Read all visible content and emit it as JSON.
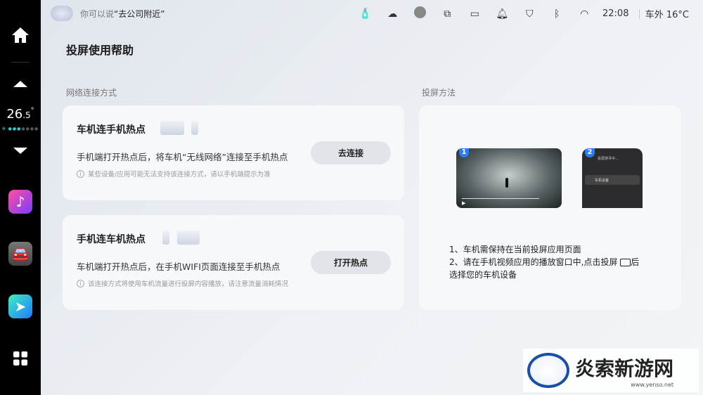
{
  "voice_hint": {
    "prefix": "你可以说",
    "command": "“去公司附近”"
  },
  "status": {
    "time": "22:08",
    "outside_temp": "车外 16°C",
    "icons": [
      "bottle-icon",
      "cloud-check-icon",
      "avatar-icon",
      "multi-screen-icon",
      "camera-icon",
      "bell-icon",
      "shield-check-icon",
      "bluetooth-icon",
      "wifi-icon"
    ]
  },
  "sidebar": {
    "temp": "26",
    "temp_decimal": ".5",
    "temp_unit": "°",
    "apps": [
      "music",
      "car",
      "navigation"
    ]
  },
  "page_title": "投屏使用帮助",
  "network": {
    "label": "网络连接方式",
    "cards": [
      {
        "title": "车机连手机热点",
        "desc": "手机端打开热点后，将车机“无线网络”连接至手机热点",
        "note": "某些设备/应用可能无法支持该连接方式，请以手机端提示为准",
        "button": "去连接"
      },
      {
        "title": "手机连车机热点",
        "desc": "车机端打开热点后，在手机WIFI页面连接至手机热点",
        "note": "该连接方式将使用车机流量进行投屏内容播放，请注意流量消耗情况",
        "button": "打开热点"
      }
    ]
  },
  "method": {
    "label": "投屏方法",
    "badge1": "1",
    "badge2": "2",
    "phone_title": "投屏搜寻中...",
    "phone_device": "车机设备",
    "step1": "1、车机需保持在当前投屏应用页面",
    "step2a": "2、请在手机视频应用的播放窗口中,点击投屏",
    "step2b": "后",
    "step2c": "选择您的车机设备"
  },
  "watermark": {
    "name": "炎索新游网",
    "url": "www.yenso.net"
  }
}
